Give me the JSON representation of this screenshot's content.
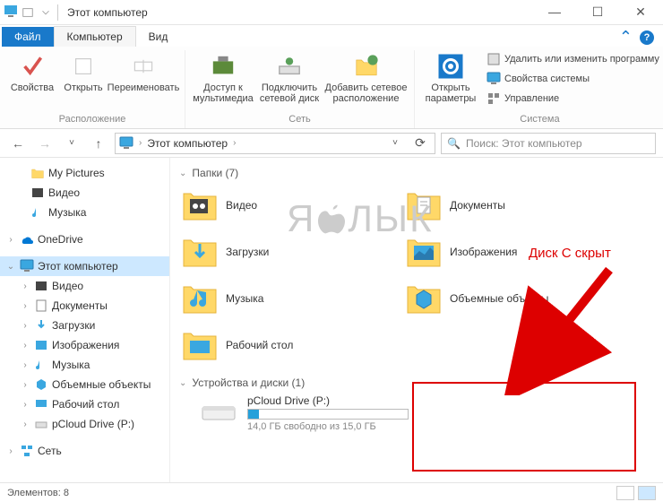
{
  "window": {
    "title": "Этот компьютер"
  },
  "tabs": {
    "file": "Файл",
    "computer": "Компьютер",
    "view": "Вид"
  },
  "ribbon": {
    "location": {
      "properties": "Свойства",
      "open": "Открыть",
      "rename": "Переименовать",
      "group": "Расположение"
    },
    "network": {
      "media": "Доступ к\nмультимедиа",
      "mapdrive": "Подключить\nсетевой диск",
      "addnet": "Добавить сетевое\nрасположение",
      "group": "Сеть"
    },
    "system": {
      "settings": "Открыть\nпараметры",
      "uninstall": "Удалить или изменить программу",
      "sysprops": "Свойства системы",
      "manage": "Управление",
      "group": "Система"
    }
  },
  "breadcrumb": {
    "root": "Этот компьютер"
  },
  "search": {
    "placeholder": "Поиск: Этот компьютер"
  },
  "tree": {
    "pictures": "My Pictures",
    "videos": "Видео",
    "music": "Музыка",
    "onedrive": "OneDrive",
    "thispc": "Этот компьютер",
    "t_videos": "Видео",
    "t_docs": "Документы",
    "t_downloads": "Загрузки",
    "t_images": "Изображения",
    "t_music": "Музыка",
    "t_3d": "Объемные объекты",
    "t_desktop": "Рабочий стол",
    "t_pcloud": "pCloud Drive (P:)",
    "network": "Сеть"
  },
  "content": {
    "folders_header": "Папки (7)",
    "folders": {
      "videos": "Видео",
      "documents": "Документы",
      "downloads": "Загрузки",
      "images": "Изображения",
      "music": "Музыка",
      "objects3d": "Объемные объекты",
      "desktop": "Рабочий стол"
    },
    "drives_header": "Устройства и диски (1)",
    "drive": {
      "name": "pCloud Drive (P:)",
      "free": "14,0 ГБ свободно из 15,0 ГБ",
      "fill_percent": 7
    }
  },
  "status": {
    "items": "Элементов: 8"
  },
  "annotation": {
    "text": "Диск C скрыт"
  },
  "watermark": "ЯБЛЫК"
}
